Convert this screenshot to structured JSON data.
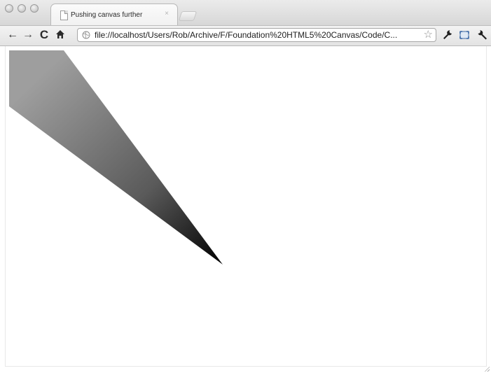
{
  "window": {
    "controls": [
      "close",
      "minimize",
      "zoom"
    ]
  },
  "tab": {
    "title": "Pushing canvas further",
    "icon": "page-icon",
    "close_glyph": "×"
  },
  "toolbar": {
    "back_glyph": "←",
    "forward_glyph": "→",
    "reload_glyph": "C",
    "home_icon": "home-icon",
    "url": "file://localhost/Users/Rob/Archive/F/Foundation%20HTML5%20Canvas/Code/C...",
    "bookmark_star": "☆",
    "right_icons": [
      "wrench-icon",
      "fullscreen-icon",
      "wrench-icon"
    ]
  },
  "canvas": {
    "shape": "gradient-filled-triangle",
    "gradient_start_color": "#9e9e9e",
    "gradient_mid_color": "#5a5a5a",
    "gradient_end_color": "#000000"
  }
}
